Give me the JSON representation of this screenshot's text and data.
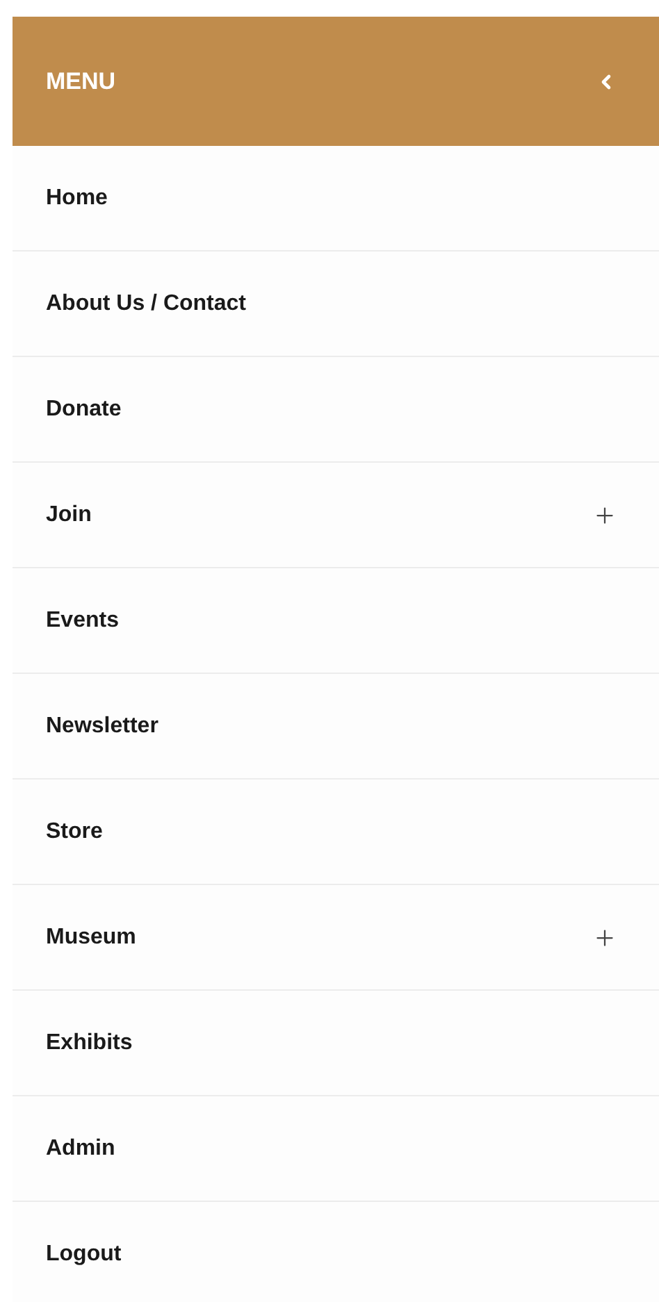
{
  "menu": {
    "title": "MENU",
    "items": [
      {
        "label": "Home",
        "kind": "link"
      },
      {
        "label": "About Us / Contact",
        "kind": "link"
      },
      {
        "label": "Donate",
        "kind": "link"
      },
      {
        "label": "Join",
        "kind": "submenu"
      },
      {
        "label": "Events",
        "kind": "link"
      },
      {
        "label": "Newsletter",
        "kind": "link"
      },
      {
        "label": "Store",
        "kind": "link"
      },
      {
        "label": "Museum",
        "kind": "submenu"
      },
      {
        "label": "Exhibits",
        "kind": "link"
      },
      {
        "label": "Admin",
        "kind": "link"
      },
      {
        "label": "Logout",
        "kind": "link"
      }
    ]
  }
}
